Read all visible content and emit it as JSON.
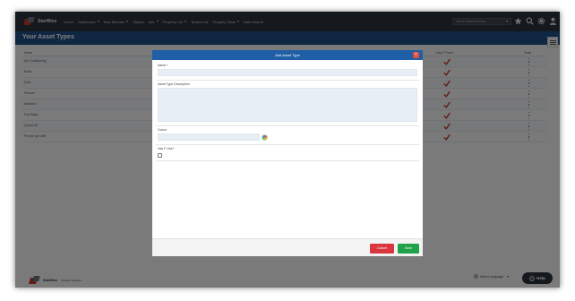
{
  "app": {
    "logo_text": "StarWise"
  },
  "nav": {
    "items": [
      {
        "label": "Home",
        "caret": false
      },
      {
        "label": "Dashboard",
        "caret": true
      },
      {
        "label": "New Member",
        "caret": true
      },
      {
        "label": "Station",
        "caret": false
      },
      {
        "label": "Info",
        "caret": true
      },
      {
        "label": "Property List",
        "caret": true
      },
      {
        "label": "Tenant List",
        "caret": false
      },
      {
        "label": "Property Stats",
        "caret": true
      },
      {
        "label": "Data Search",
        "caret": false
      }
    ],
    "customer_select": "Test & Demonstration",
    "icons": [
      "star-icon",
      "search-icon",
      "gear-icon",
      "user-icon"
    ]
  },
  "page": {
    "title": "Your Asset Types"
  },
  "table": {
    "headers": {
      "name": "Name",
      "has_fuse": "Has F Fuse?",
      "tools": "Tools"
    },
    "rows": [
      {
        "name": "Air Conditioning",
        "has_fuse": true
      },
      {
        "name": "Boiler",
        "has_fuse": true
      },
      {
        "name": "Drier",
        "has_fuse": true
      },
      {
        "name": "Freezer",
        "has_fuse": true
      },
      {
        "name": "Intratech",
        "has_fuse": true
      },
      {
        "name": "Pod Basic",
        "has_fuse": true
      },
      {
        "name": "Quartz-lift",
        "has_fuse": true
      },
      {
        "name": "Prompt get wifit",
        "has_fuse": true
      }
    ]
  },
  "modal": {
    "title": "Add Asset Type",
    "fields": {
      "name_label": "Name *",
      "description_label": "Asset Type Description",
      "colour_label": "Colour",
      "has_fuse_label": "Has F Use?"
    },
    "buttons": {
      "cancel": "Cancel",
      "save": "Save"
    }
  },
  "footer": {
    "logo_text": "StarWise",
    "version": "Version Software",
    "language": "Select Language",
    "help": "Help"
  },
  "colors": {
    "nav_bg": "#2a3139",
    "header_blue": "#1f4f86",
    "modal_head": "#1f5fa8",
    "cancel_red": "#d9363e",
    "save_green": "#1ea34a",
    "check_red": "#c0392b"
  }
}
